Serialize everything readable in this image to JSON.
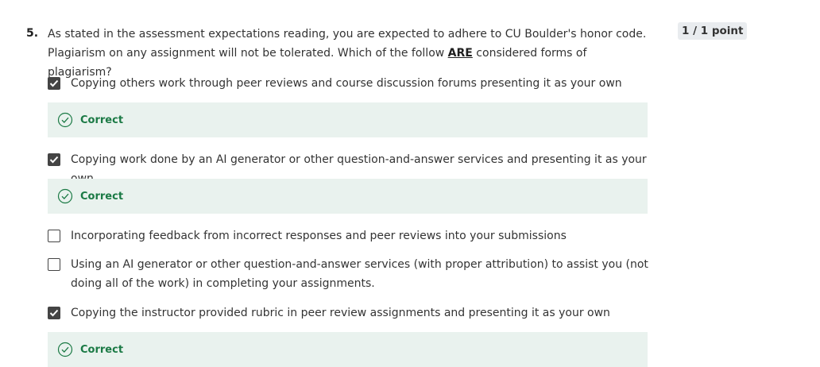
{
  "question": {
    "number": "5.",
    "text_part1": "As stated in the assessment expectations reading, you are expected to adhere to CU Boulder's honor code. Plagiarism on any assignment will not be tolerated. Which of the follow ",
    "text_emphasis": "ARE",
    "text_part2": " considered forms of plagiarism?",
    "points": "1 / 1 point"
  },
  "options": [
    {
      "label": "Copying others work through peer reviews and course discussion forums presenting it as your own",
      "checked": true
    },
    {
      "label": "Copying work done by an AI generator or other question-and-answer services and presenting it as your own",
      "checked": true
    },
    {
      "label": "Incorporating feedback from incorrect responses and peer reviews into your submissions",
      "checked": false
    },
    {
      "label": "Using an AI generator or other question-and-answer services (with proper attribution) to assist you (not doing all of the work) in completing your assignments.",
      "checked": false
    },
    {
      "label": "Copying the instructor provided rubric in peer review assignments and presenting it as your own",
      "checked": true
    }
  ],
  "feedback": [
    {
      "label": "Correct"
    },
    {
      "label": "Correct"
    },
    {
      "label": "Correct"
    }
  ],
  "colors": {
    "correct_bg": "#e9f2ee",
    "correct_text": "#1b7a45",
    "checkbox": "#444444"
  }
}
